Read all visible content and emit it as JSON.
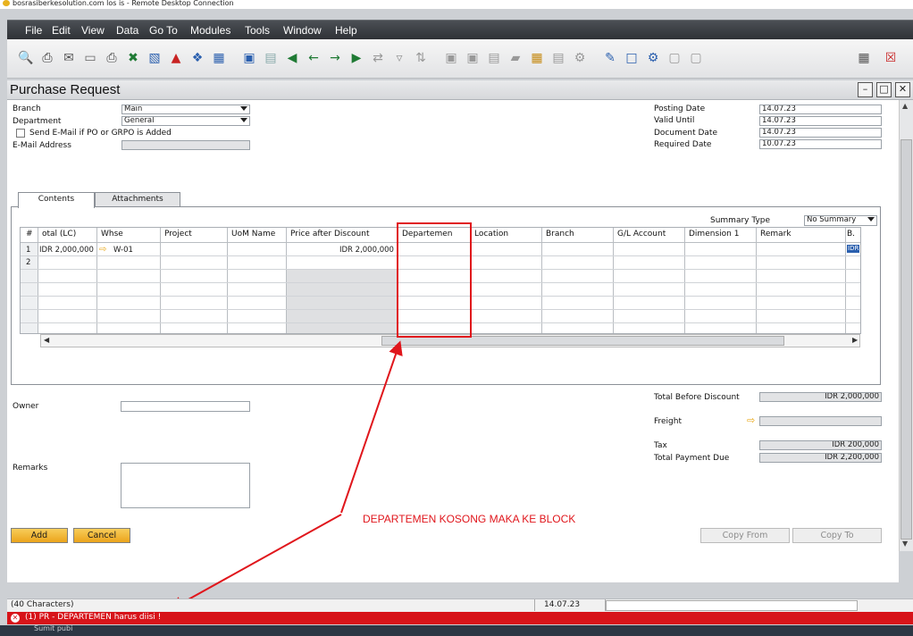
{
  "window": {
    "title": "bosrasiberkesolution.com los is - Remote Desktop Connection"
  },
  "menu": [
    "File",
    "Edit",
    "View",
    "Data",
    "Go To",
    "Modules",
    "Tools",
    "Window",
    "Help"
  ],
  "form": {
    "title": "Purchase Request"
  },
  "header_left": {
    "branch_label": "Branch",
    "branch_value": "Main",
    "department_label": "Department",
    "department_value": "General",
    "email_checkbox_label": "Send E-Mail if PO or GRPO is Added",
    "email_address_label": "E-Mail Address",
    "email_address_value": ""
  },
  "header_right": {
    "posting_date_label": "Posting Date",
    "posting_date": "14.07.23",
    "valid_until_label": "Valid Until",
    "valid_until": "14.07.23",
    "document_date_label": "Document Date",
    "document_date": "14.07.23",
    "required_date_label": "Required Date",
    "required_date": "10.07.23"
  },
  "tabs": [
    "Contents",
    "Attachments"
  ],
  "summary": {
    "label": "Summary Type",
    "value": "No Summary"
  },
  "grid": {
    "columns": [
      "#",
      "otal (LC)",
      "Whse",
      "Project",
      "UoM Name",
      "Price after Discount",
      "Departemen",
      "Location",
      "Branch",
      "G/L Account",
      "Dimension 1",
      "Remark",
      "B."
    ],
    "rows": [
      {
        "num": "1",
        "total": "IDR 2,000,000",
        "whse": "W-01",
        "price": "IDR 2,000,000",
        "b": "IDR"
      },
      {
        "num": "2"
      }
    ]
  },
  "bottom_left": {
    "owner_label": "Owner",
    "remarks_label": "Remarks"
  },
  "totals": {
    "before_discount_label": "Total Before Discount",
    "before_discount": "IDR 2,000,000",
    "freight_label": "Freight",
    "tax_label": "Tax",
    "tax": "IDR 200,000",
    "payment_due_label": "Total Payment Due",
    "payment_due": "IDR 2,200,000"
  },
  "buttons": {
    "add": "Add",
    "cancel": "Cancel",
    "copy_from": "Copy From",
    "copy_to": "Copy To"
  },
  "status": {
    "chars": "(40 Characters)",
    "date": "14.07.23"
  },
  "error": {
    "message": "(1) PR - DEPARTEMEN harus diisi !"
  },
  "annotation": {
    "text": "DEPARTEMEN KOSONG MAKA KE BLOCK"
  },
  "taskbar": {
    "item": "Sumit pubi"
  },
  "colors": {
    "error": "#d7141a",
    "annotation": "#e0161c",
    "accent_button": "#f0b429",
    "menubar": "#3a3d42"
  }
}
